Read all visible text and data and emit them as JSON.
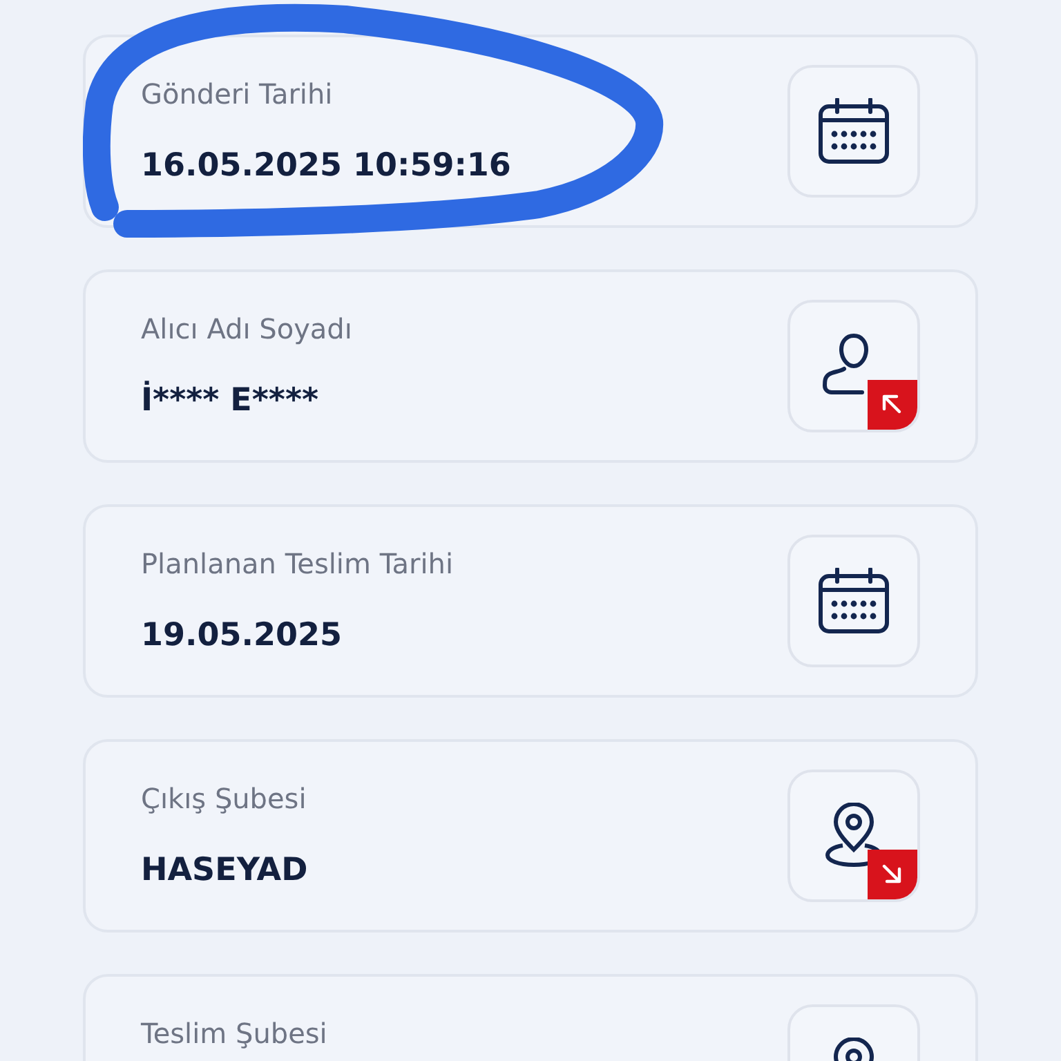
{
  "cards": [
    {
      "label": "Gönderi Tarihi",
      "value": "16.05.2025 10:59:16",
      "kind": "calendar"
    },
    {
      "label": "Alıcı Adı Soyadı",
      "value": "İ**** E****",
      "kind": "recipient"
    },
    {
      "label": "Planlanan Teslim Tarihi",
      "value": "19.05.2025",
      "kind": "calendar"
    },
    {
      "label": "Çıkış Şubesi",
      "value": "HASEYAD",
      "kind": "origin"
    },
    {
      "label": "Teslim Şubesi",
      "kind": "destination"
    }
  ]
}
